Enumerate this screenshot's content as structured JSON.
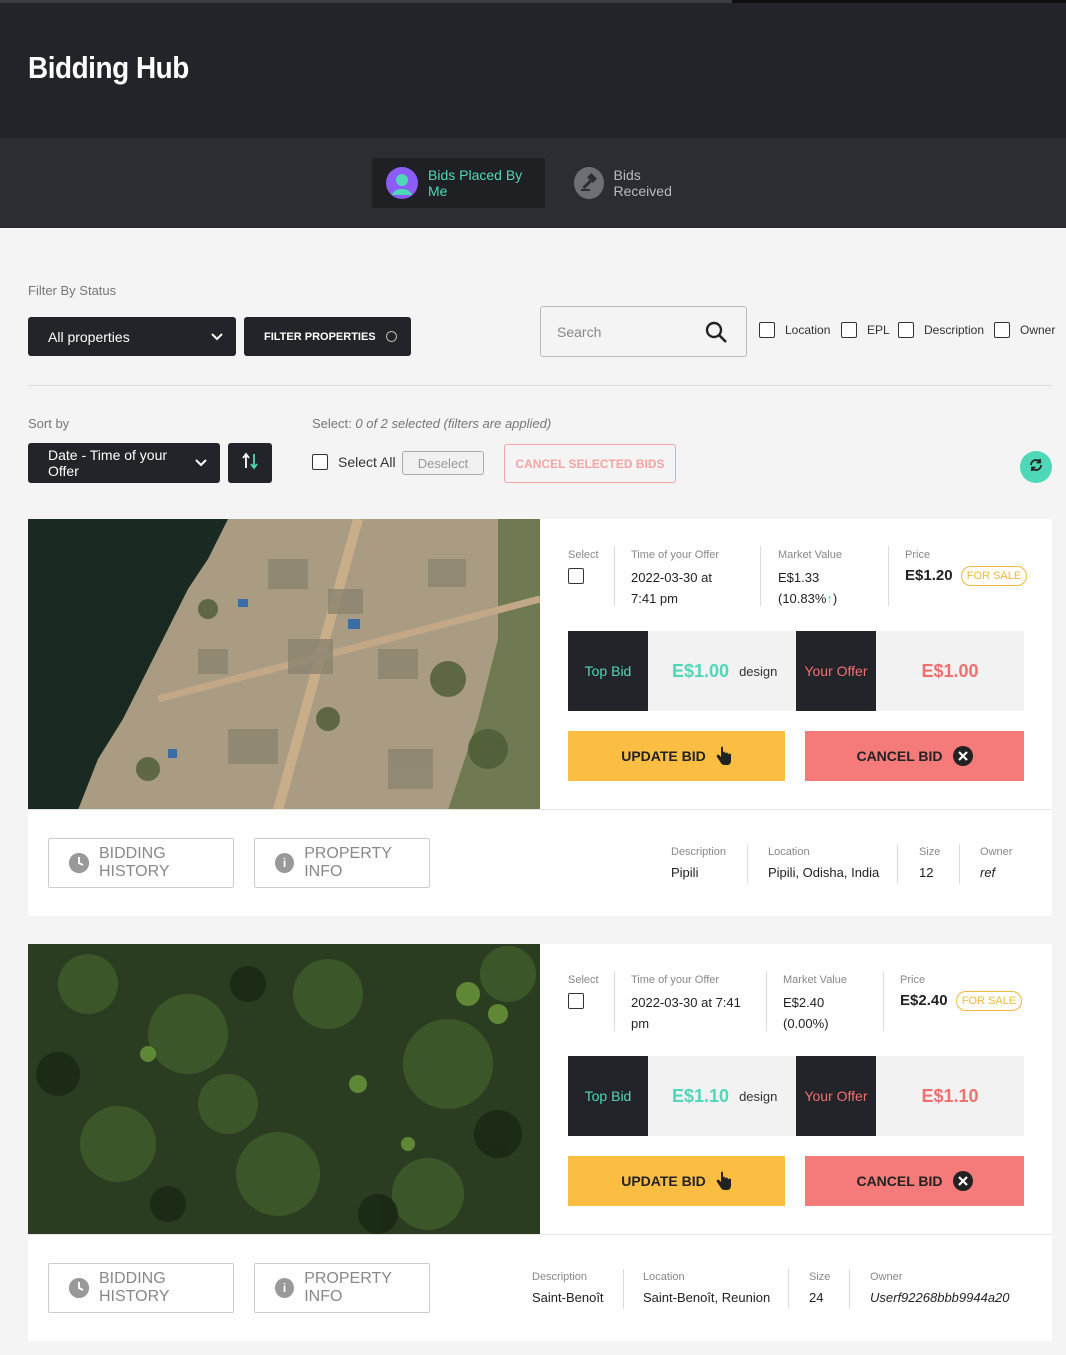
{
  "header": {
    "title": "Bidding Hub"
  },
  "tabs": [
    {
      "label": "Bids Placed By Me",
      "icon": "user-icon",
      "active": true
    },
    {
      "label": "Bids Received",
      "icon": "gavel-icon",
      "active": false
    }
  ],
  "filters": {
    "status_label": "Filter By Status",
    "status_value": "All properties",
    "filter_button": "FILTER PROPERTIES",
    "search_placeholder": "Search",
    "checkboxes": [
      "Location",
      "EPL",
      "Description",
      "Owner"
    ]
  },
  "sort": {
    "label": "Sort by",
    "value": "Date - Time of your Offer"
  },
  "selection": {
    "label": "Select:",
    "info": "0 of 2 selected (filters are applied)",
    "select_all": "Select All",
    "deselect": "Deselect",
    "cancel_selected": "CANCEL SELECTED BIDS"
  },
  "card_labels": {
    "select": "Select",
    "time": "Time of your Offer",
    "market": "Market Value",
    "price": "Price",
    "badge": "FOR SALE",
    "top_bid": "Top Bid",
    "your_offer": "Your Offer",
    "update": "UPDATE BID",
    "cancel": "CANCEL BID",
    "history": "BIDDING HISTORY",
    "info": "PROPERTY INFO",
    "f_description": "Description",
    "f_location": "Location",
    "f_size": "Size",
    "f_owner": "Owner"
  },
  "bids": [
    {
      "time_line1": "2022-03-30 at",
      "time_line2": "7:41 pm",
      "market_value": "E$1.33",
      "market_change": "(10.83%",
      "market_arrow": "↑",
      "market_close": ")",
      "price": "E$1.20",
      "top_bid": "E$1.00",
      "top_bidder": "design",
      "your_offer": "E$1.00",
      "description": "Pipili",
      "location": "Pipili, Odisha, India",
      "size": "12",
      "owner": "ref"
    },
    {
      "time_line1": "2022-03-30 at 7:41",
      "time_line2": "pm",
      "market_value": "E$2.40",
      "market_change": "(0.00%)",
      "market_arrow": "",
      "market_close": "",
      "price": "E$2.40",
      "top_bid": "E$1.10",
      "top_bidder": "design",
      "your_offer": "E$1.10",
      "description": "Saint-Benoît",
      "location": "Saint-Benoît, Reunion",
      "size": "24",
      "owner": "Userf92268bbb9944a20"
    }
  ],
  "colors": {
    "accent_green": "#4fd8b8",
    "accent_yellow": "#fbbe43",
    "accent_red": "#f57a7a",
    "dark": "#232429"
  }
}
